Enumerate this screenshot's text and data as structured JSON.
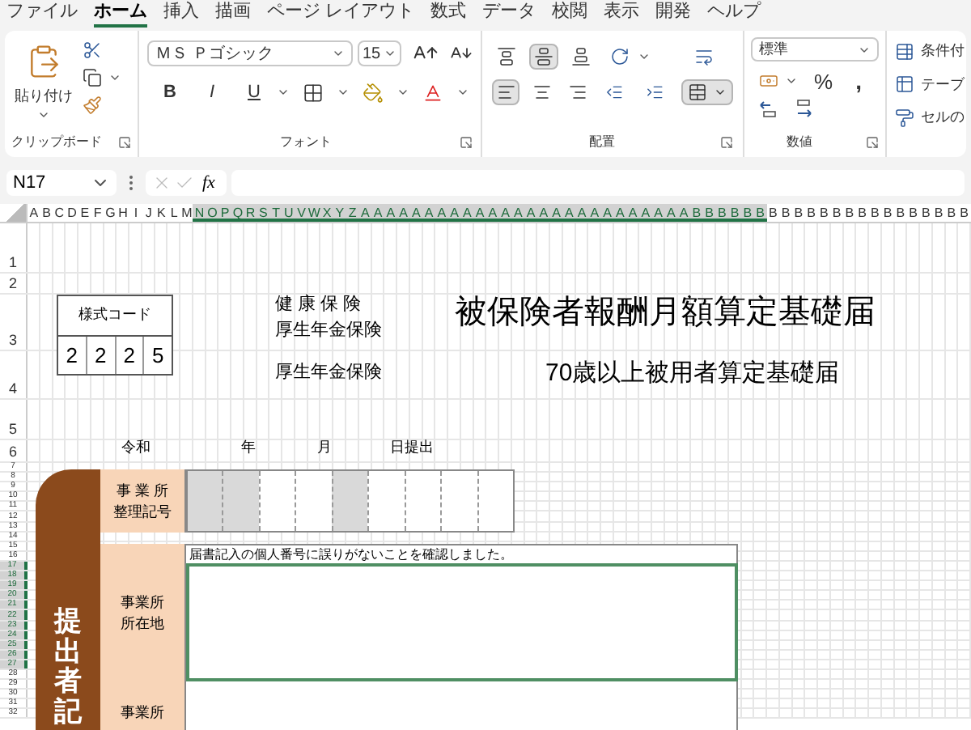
{
  "ribbon_tabs": [
    {
      "label": "ファイル",
      "selected": false
    },
    {
      "label": "ホーム",
      "selected": true
    },
    {
      "label": "挿入",
      "selected": false
    },
    {
      "label": "描画",
      "selected": false
    },
    {
      "label": "ページ レイアウト",
      "selected": false
    },
    {
      "label": "数式",
      "selected": false
    },
    {
      "label": "データ",
      "selected": false
    },
    {
      "label": "校閲",
      "selected": false
    },
    {
      "label": "表示",
      "selected": false
    },
    {
      "label": "開発",
      "selected": false
    },
    {
      "label": "ヘルプ",
      "selected": false
    }
  ],
  "clipboard": {
    "paste_label": "貼り付け",
    "group_label": "クリップボード"
  },
  "font": {
    "name": "ＭＳ Ｐゴシック",
    "size": "15",
    "bold": "B",
    "italic": "I",
    "underline": "U",
    "group_label": "フォント"
  },
  "alignment": {
    "vertical_buttons": [
      {
        "selected": false
      },
      {
        "selected": true
      },
      {
        "selected": false
      }
    ],
    "horizontal_buttons": [
      {
        "selected": true
      },
      {
        "selected": false
      },
      {
        "selected": false
      }
    ],
    "merged": true,
    "group_label": "配置"
  },
  "number": {
    "format": "標準",
    "percent": "%",
    "comma": ",",
    "group_label": "数値"
  },
  "styles": [
    "条件付",
    "テーブ",
    "セルの"
  ],
  "formula_bar": {
    "name_box": "N17",
    "fx": "fx"
  },
  "column_headers": [
    {
      "label": "A",
      "selected": false
    },
    {
      "label": "B",
      "selected": false
    },
    {
      "label": "C",
      "selected": false
    },
    {
      "label": "D",
      "selected": false
    },
    {
      "label": "E",
      "selected": false
    },
    {
      "label": "F",
      "selected": false
    },
    {
      "label": "G",
      "selected": false
    },
    {
      "label": "H",
      "selected": false
    },
    {
      "label": "I",
      "selected": false
    },
    {
      "label": "J",
      "selected": false
    },
    {
      "label": "K",
      "selected": false
    },
    {
      "label": "L",
      "selected": false
    },
    {
      "label": "M",
      "selected": false
    },
    {
      "label": "N",
      "selected": true
    },
    {
      "label": "O",
      "selected": true
    },
    {
      "label": "P",
      "selected": true
    },
    {
      "label": "Q",
      "selected": true
    },
    {
      "label": "R",
      "selected": true
    },
    {
      "label": "S",
      "selected": true
    },
    {
      "label": "T",
      "selected": true
    },
    {
      "label": "U",
      "selected": true
    },
    {
      "label": "V",
      "selected": true
    },
    {
      "label": "W",
      "selected": true
    },
    {
      "label": "X",
      "selected": true
    },
    {
      "label": "Y",
      "selected": true
    },
    {
      "label": "Z",
      "selected": true
    },
    {
      "label": "A",
      "selected": true
    },
    {
      "label": "A",
      "selected": true
    },
    {
      "label": "A",
      "selected": true
    },
    {
      "label": "A",
      "selected": true
    },
    {
      "label": "A",
      "selected": true
    },
    {
      "label": "A",
      "selected": true
    },
    {
      "label": "A",
      "selected": true
    },
    {
      "label": "A",
      "selected": true
    },
    {
      "label": "A",
      "selected": true
    },
    {
      "label": "A",
      "selected": true
    },
    {
      "label": "A",
      "selected": true
    },
    {
      "label": "A",
      "selected": true
    },
    {
      "label": "A",
      "selected": true
    },
    {
      "label": "A",
      "selected": true
    },
    {
      "label": "A",
      "selected": true
    },
    {
      "label": "A",
      "selected": true
    },
    {
      "label": "A",
      "selected": true
    },
    {
      "label": "A",
      "selected": true
    },
    {
      "label": "A",
      "selected": true
    },
    {
      "label": "A",
      "selected": true
    },
    {
      "label": "A",
      "selected": true
    },
    {
      "label": "A",
      "selected": true
    },
    {
      "label": "A",
      "selected": true
    },
    {
      "label": "A",
      "selected": true
    },
    {
      "label": "A",
      "selected": true
    },
    {
      "label": "A",
      "selected": true
    },
    {
      "label": "B",
      "selected": true
    },
    {
      "label": "B",
      "selected": true
    },
    {
      "label": "B",
      "selected": true
    },
    {
      "label": "B",
      "selected": true
    },
    {
      "label": "B",
      "selected": true
    },
    {
      "label": "B",
      "selected": true
    },
    {
      "label": "B",
      "selected": false
    },
    {
      "label": "B",
      "selected": false
    },
    {
      "label": "B",
      "selected": false
    },
    {
      "label": "B",
      "selected": false
    },
    {
      "label": "B",
      "selected": false
    },
    {
      "label": "B",
      "selected": false
    },
    {
      "label": "B",
      "selected": false
    },
    {
      "label": "B",
      "selected": false
    },
    {
      "label": "B",
      "selected": false
    },
    {
      "label": "B",
      "selected": false
    },
    {
      "label": "B",
      "selected": false
    },
    {
      "label": "B",
      "selected": false
    },
    {
      "label": "B",
      "selected": false
    },
    {
      "label": "B",
      "selected": false
    },
    {
      "label": "B",
      "selected": false
    },
    {
      "label": "B",
      "selected": false
    }
  ],
  "row_headers": [
    {
      "label": "1",
      "selected": false
    },
    {
      "label": "2",
      "selected": false
    },
    {
      "label": "3",
      "selected": false
    },
    {
      "label": "4",
      "selected": false
    },
    {
      "label": "5",
      "selected": false
    },
    {
      "label": "6",
      "selected": false
    },
    {
      "label": "7",
      "selected": false
    },
    {
      "label": "8",
      "selected": false
    },
    {
      "label": "9",
      "selected": false
    },
    {
      "label": "10",
      "selected": false
    },
    {
      "label": "11",
      "selected": false
    },
    {
      "label": "12",
      "selected": false
    },
    {
      "label": "13",
      "selected": false
    },
    {
      "label": "14",
      "selected": false
    },
    {
      "label": "15",
      "selected": false
    },
    {
      "label": "16",
      "selected": false
    },
    {
      "label": "17",
      "selected": true
    },
    {
      "label": "18",
      "selected": true
    },
    {
      "label": "19",
      "selected": true
    },
    {
      "label": "20",
      "selected": true
    },
    {
      "label": "21",
      "selected": true
    },
    {
      "label": "22",
      "selected": true
    },
    {
      "label": "23",
      "selected": true
    },
    {
      "label": "24",
      "selected": true
    },
    {
      "label": "25",
      "selected": true
    },
    {
      "label": "26",
      "selected": true
    },
    {
      "label": "27",
      "selected": true
    },
    {
      "label": "28",
      "selected": false
    },
    {
      "label": "29",
      "selected": false
    },
    {
      "label": "30",
      "selected": false
    },
    {
      "label": "31",
      "selected": false
    },
    {
      "label": "32",
      "selected": false
    }
  ],
  "sheet": {
    "form_code": {
      "label": "様式コード",
      "digits": [
        "2",
        "2",
        "2",
        "5"
      ]
    },
    "insurance_lines": [
      "健 康 保 険",
      "厚生年金保険"
    ],
    "title": "被保険者報酬月額算定基礎届",
    "sub_insurance": "厚生年金保険",
    "subtitle": "70歳以上被用者算定基礎届",
    "date_labels": [
      "令和",
      "年",
      "月",
      "日提出"
    ],
    "submitter_label": "提出者記",
    "office_number": {
      "label_lines": [
        "事 業 所",
        "整理記号"
      ],
      "cells": [
        {
          "shaded": true
        },
        {
          "shaded": true
        },
        {
          "shaded": false
        },
        {
          "shaded": false
        },
        {
          "shaded": true
        },
        {
          "shaded": false
        },
        {
          "shaded": false
        },
        {
          "shaded": false
        },
        {
          "shaded": false
        }
      ]
    },
    "confirmation_note": "届書記入の個人番号に誤りがないことを確認しました。",
    "office_address": {
      "label_lines": [
        "事業所",
        "所在地"
      ]
    },
    "office_name": {
      "label": "事業所"
    }
  }
}
